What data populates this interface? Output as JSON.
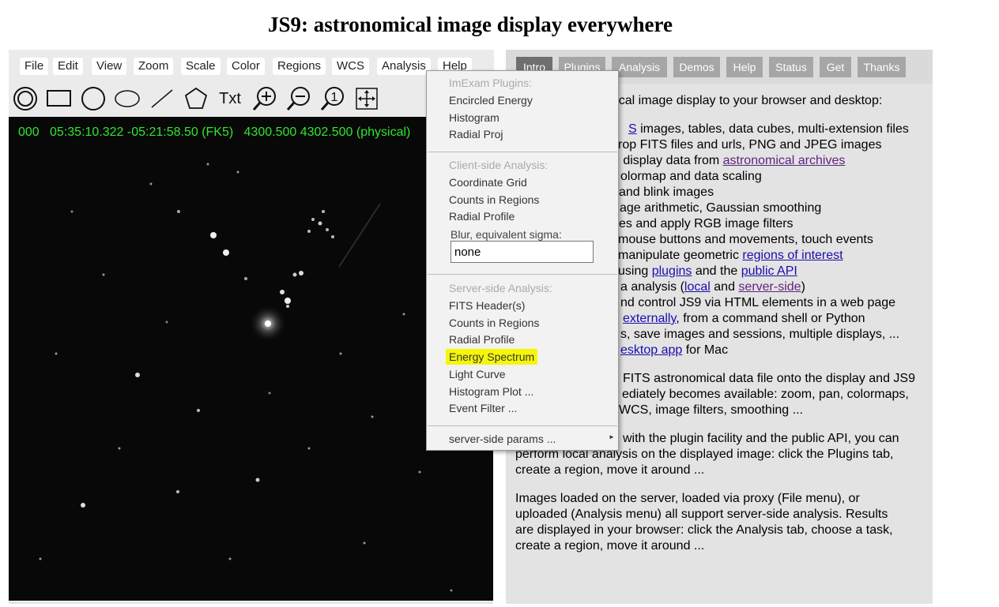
{
  "page": {
    "title": "JS9: astronomical image display everywhere"
  },
  "menubar": {
    "items": [
      "File",
      "Edit",
      "View",
      "Zoom",
      "Scale",
      "Color",
      "Regions",
      "WCS",
      "Analysis",
      "Help"
    ]
  },
  "toolbar": {
    "tools": [
      "annulus-tool-icon",
      "box-tool-icon",
      "circle-tool-icon",
      "ellipse-tool-icon",
      "line-tool-icon",
      "polygon-tool-icon",
      "text-tool-icon",
      "zoom-in-icon",
      "zoom-out-icon",
      "zoom-one-icon",
      "pan-move-icon"
    ],
    "text_tool_label": "Txt"
  },
  "display": {
    "info": "000   05:35:10.322 -05:21:58.50 (FK5)   4300.500 4302.500 (physical)",
    "info_color": "#2fe62f"
  },
  "tabs": {
    "items": [
      "Intro",
      "Plugins",
      "Analysis",
      "Demos",
      "Help",
      "Status",
      "Get",
      "Thanks"
    ],
    "active": "Intro"
  },
  "content": {
    "intro_fragment": "omical image display to your browser and desktop:",
    "bullets": [
      {
        "pre": "",
        "link": "S",
        "post": " images, tables, data cubes, multi-extension files"
      },
      {
        "pre": "rop FITS files and urls, PNG and JPEG images",
        "link": "",
        "post": ""
      },
      {
        "pre": "d display data from ",
        "link": "astronomical archives",
        "post": ""
      },
      {
        "pre": "olormap and data scaling",
        "link": "",
        "post": ""
      },
      {
        "pre": " and blink images",
        "link": "",
        "post": ""
      },
      {
        "pre": "age arithmetic, Gaussian smoothing",
        "link": "",
        "post": ""
      },
      {
        "pre": "es and apply RGB image filters",
        "link": "",
        "post": ""
      },
      {
        "pre": "mouse buttons and movements, touch events",
        "link": "",
        "post": ""
      },
      {
        "pre": "manipulate geometric ",
        "link": "regions of interest",
        "post": ""
      },
      {
        "pre": " using ",
        "link": "plugins",
        "mid": " and the ",
        "link2": "public API",
        "post": ""
      },
      {
        "pre": "a analysis (",
        "link": "local",
        "mid": " and ",
        "link2": "server-side",
        "post": ")"
      },
      {
        "pre": "nd control JS9 via HTML elements in a web page",
        "link": "",
        "post": ""
      },
      {
        "pre": "",
        "link": "externally",
        "post": ", from a command shell or Python"
      },
      {
        "pre": "s, save images and sessions, multiple displays, ...",
        "link": "",
        "post": ""
      },
      {
        "pre": "",
        "link": "esktop app",
        "post": " for Mac"
      }
    ],
    "para2": [
      "FITS astronomical data file onto the display and JS9",
      "ediately becomes available: zoom, pan, colormaps,",
      "WCS, image filters, smoothing ..."
    ],
    "para3": [
      "with the plugin facility and the public API, you can",
      "perform local analysis on the displayed image: click the Plugins tab,",
      "create a region, move it around ..."
    ],
    "para4": [
      "Images loaded on the server, loaded via proxy (File menu), or",
      "uploaded (Analysis menu) all support server-side analysis. Results",
      "are displayed in your browser: click the Analysis tab, choose a task,",
      "create a region, move it around ..."
    ]
  },
  "analysis_menu": {
    "imexam_header": "ImExam Plugins:",
    "imexam_items": [
      "Encircled Energy",
      "Histogram",
      "Radial Proj"
    ],
    "client_header": "Client-side Analysis:",
    "client_items": [
      "Coordinate Grid",
      "Counts in Regions",
      "Radial Profile"
    ],
    "blur_label": "Blur, equivalent sigma:",
    "blur_value": "none",
    "server_header": "Server-side Analysis:",
    "server_items": [
      "FITS Header(s)",
      "Counts in Regions",
      "Radial Profile",
      "Energy Spectrum",
      "Light Curve",
      "Histogram Plot ...",
      "Event Filter ..."
    ],
    "highlighted_item": "Energy Spectrum",
    "highlight_color": "#f6f60a",
    "params_item": "server-side params ...",
    "params_arrow": "►"
  }
}
